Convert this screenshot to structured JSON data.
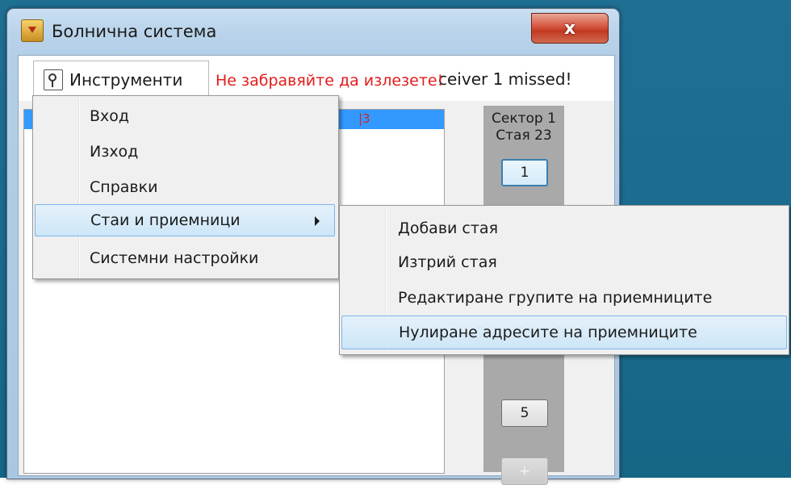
{
  "window": {
    "title": "Болнична система",
    "close_label": "x"
  },
  "menubar": {
    "tools_label": "Инструменти",
    "warning": "Не забравяйте да излезете!",
    "status": "ceiver 1 missed!"
  },
  "list": {
    "selected_text": "|3"
  },
  "sector": {
    "sector_label": "Сектор 1",
    "room_label": "Стая 23",
    "buttons": [
      "1",
      "5",
      "+"
    ]
  },
  "tools_menu": {
    "items": [
      "Вход",
      "Изход",
      "Справки",
      "Стаи и приемници",
      "Системни настройки"
    ],
    "highlighted_index": 3
  },
  "rooms_submenu": {
    "items": [
      "Добави стая",
      "Изтрий стая",
      "Редактиране групите на приемниците",
      "Нулиране адресите на приемниците"
    ],
    "highlighted_index": 3
  },
  "colors": {
    "desktop": "#1a6b8e",
    "warning_text": "#e21b1b",
    "selection": "#3399ff",
    "menu_highlight_border": "#7eb4ea"
  }
}
